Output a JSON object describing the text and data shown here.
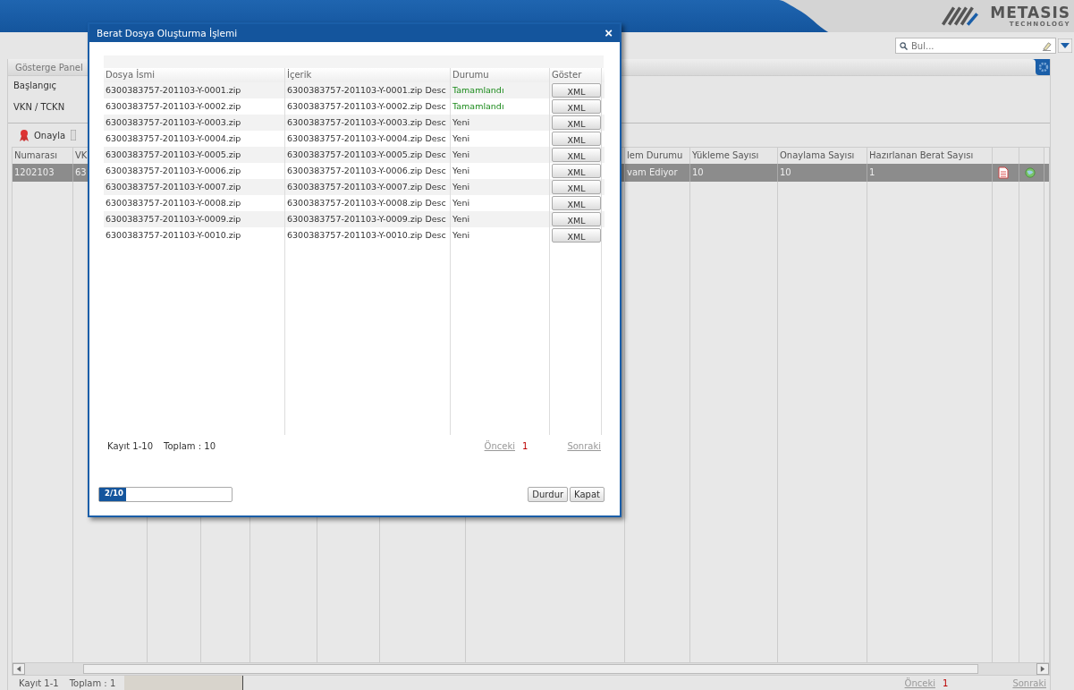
{
  "header": {
    "logo_name": "METASIS",
    "logo_tagline": "TECHNOLOGY"
  },
  "search": {
    "placeholder": "Bul..."
  },
  "panel": {
    "tab": "Gösterge Panel",
    "fields": [
      "Başlangıç",
      "VKN / TCKN"
    ]
  },
  "toolbar": {
    "buttons": [
      "Onayla"
    ]
  },
  "grid": {
    "headers": [
      "Numarası",
      "VK",
      "lem Durumu",
      "Yükleme Sayısı",
      "Onaylama Sayısı",
      "Hazırlanan Berat Sayısı"
    ],
    "rows": [
      {
        "selected": true,
        "cells": [
          "1202103",
          "63",
          "vam Ediyor",
          "10",
          "10",
          "1"
        ]
      }
    ],
    "footer": {
      "records": "Kayıt 1-1",
      "total": "Toplam : 1",
      "prev": "Önceki",
      "page": "1",
      "next": "Sonraki"
    }
  },
  "dialog": {
    "title": "Berat Dosya Oluşturma İşlemi",
    "close": "×",
    "columns": [
      "Dosya İsmi",
      "İçerik",
      "Durumu",
      "Göster"
    ],
    "rows": [
      {
        "file": "6300383757-201103-Y-0001.zip",
        "content": "6300383757-201103-Y-0001.zip Desc",
        "status": "Tamamlandı",
        "kind": "done",
        "button": "XML"
      },
      {
        "file": "6300383757-201103-Y-0002.zip",
        "content": "6300383757-201103-Y-0002.zip Desc",
        "status": "Tamamlandı",
        "kind": "done",
        "button": "XML"
      },
      {
        "file": "6300383757-201103-Y-0003.zip",
        "content": "6300383757-201103-Y-0003.zip Desc",
        "status": "Yeni",
        "kind": "new",
        "button": "XML"
      },
      {
        "file": "6300383757-201103-Y-0004.zip",
        "content": "6300383757-201103-Y-0004.zip Desc",
        "status": "Yeni",
        "kind": "new",
        "button": "XML"
      },
      {
        "file": "6300383757-201103-Y-0005.zip",
        "content": "6300383757-201103-Y-0005.zip Desc",
        "status": "Yeni",
        "kind": "new",
        "button": "XML"
      },
      {
        "file": "6300383757-201103-Y-0006.zip",
        "content": "6300383757-201103-Y-0006.zip Desc",
        "status": "Yeni",
        "kind": "new",
        "button": "XML"
      },
      {
        "file": "6300383757-201103-Y-0007.zip",
        "content": "6300383757-201103-Y-0007.zip Desc",
        "status": "Yeni",
        "kind": "new",
        "button": "XML"
      },
      {
        "file": "6300383757-201103-Y-0008.zip",
        "content": "6300383757-201103-Y-0008.zip Desc",
        "status": "Yeni",
        "kind": "new",
        "button": "XML"
      },
      {
        "file": "6300383757-201103-Y-0009.zip",
        "content": "6300383757-201103-Y-0009.zip Desc",
        "status": "Yeni",
        "kind": "new",
        "button": "XML"
      },
      {
        "file": "6300383757-201103-Y-0010.zip",
        "content": "6300383757-201103-Y-0010.zip Desc",
        "status": "Yeni",
        "kind": "new",
        "button": "XML"
      }
    ],
    "footer": {
      "records": "Kayıt 1-10",
      "total": "Toplam : 10",
      "prev": "Önceki",
      "page": "1",
      "next": "Sonraki"
    },
    "progress": {
      "label": "2/10",
      "level": 0.2
    },
    "buttons": [
      "Durdur",
      "Kapat"
    ]
  }
}
